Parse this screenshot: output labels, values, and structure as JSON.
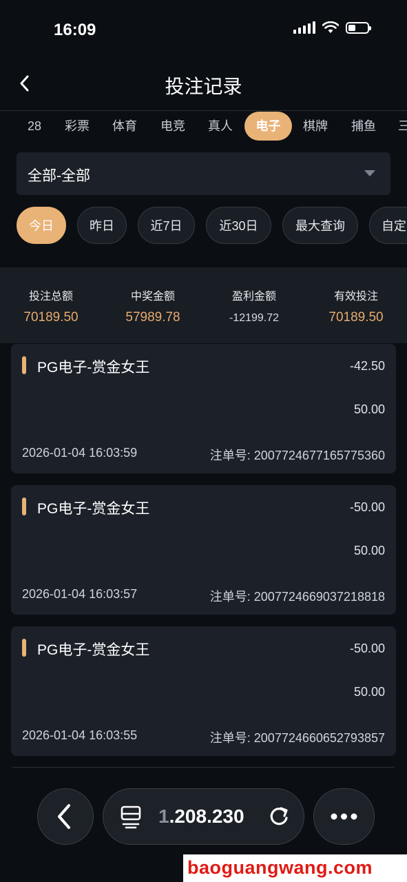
{
  "status_bar": {
    "time": "16:09"
  },
  "header": {
    "title": "投注记录"
  },
  "category_tabs": [
    {
      "label": "28",
      "active": false
    },
    {
      "label": "彩票",
      "active": false
    },
    {
      "label": "体育",
      "active": false
    },
    {
      "label": "电竞",
      "active": false
    },
    {
      "label": "真人",
      "active": false
    },
    {
      "label": "电子",
      "active": true
    },
    {
      "label": "棋牌",
      "active": false
    },
    {
      "label": "捕鱼",
      "active": false
    },
    {
      "label": "三",
      "active": false
    }
  ],
  "filter": {
    "selected": "全部-全部"
  },
  "date_ranges": [
    {
      "label": "今日",
      "active": true
    },
    {
      "label": "昨日",
      "active": false
    },
    {
      "label": "近7日",
      "active": false
    },
    {
      "label": "近30日",
      "active": false
    },
    {
      "label": "最大查询",
      "active": false
    },
    {
      "label": "自定",
      "active": false
    }
  ],
  "summary": [
    {
      "label": "投注总额",
      "value": "70189.50"
    },
    {
      "label": "中奖金额",
      "value": "57989.78"
    },
    {
      "label": "盈利金额",
      "value": "-12199.72"
    },
    {
      "label": "有效投注",
      "value": "70189.50"
    }
  ],
  "records": [
    {
      "game": "PG电子-赏金女王",
      "profit": "-42.50",
      "bet": "50.00",
      "time": "2026-01-04 16:03:59",
      "order": "注单号: 2007724677165775360"
    },
    {
      "game": "PG电子-赏金女王",
      "profit": "-50.00",
      "bet": "50.00",
      "time": "2026-01-04 16:03:57",
      "order": "注单号: 2007724669037218818"
    },
    {
      "game": "PG电子-赏金女王",
      "profit": "-50.00",
      "bet": "50.00",
      "time": "2026-01-04 16:03:55",
      "order": "注单号: 2007724660652793857"
    }
  ],
  "toolbar": {
    "address_prefix": "1",
    "address_rest": ".208.230"
  },
  "watermark": "baoguangwang.com",
  "colors": {
    "accent": "#e9b276",
    "background": "#0b0f14",
    "card": "#1c2129"
  }
}
